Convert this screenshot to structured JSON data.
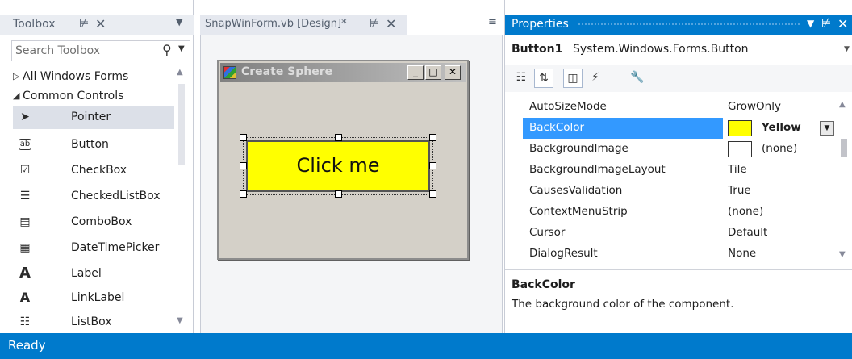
{
  "toolbox": {
    "title": "Toolbox",
    "search_placeholder": "Search Toolbox",
    "categories": [
      {
        "label": "All Windows Forms",
        "expanded": false
      },
      {
        "label": "Common Controls",
        "expanded": true
      }
    ],
    "items": [
      {
        "label": "Pointer",
        "icon": "pointer-icon",
        "selected": true
      },
      {
        "label": "Button",
        "icon": "button-icon"
      },
      {
        "label": "CheckBox",
        "icon": "checkbox-icon"
      },
      {
        "label": "CheckedListBox",
        "icon": "checkedlistbox-icon"
      },
      {
        "label": "ComboBox",
        "icon": "combobox-icon"
      },
      {
        "label": "DateTimePicker",
        "icon": "datetimepicker-icon"
      },
      {
        "label": "Label",
        "icon": "label-icon"
      },
      {
        "label": "LinkLabel",
        "icon": "linklabel-icon"
      },
      {
        "label": "ListBox",
        "icon": "listbox-icon"
      }
    ]
  },
  "designer": {
    "tab_title": "SnapWinForm.vb [Design]*",
    "form": {
      "title": "Create Sphere",
      "button_text": "Click me",
      "button_color": "#ffff00"
    }
  },
  "properties": {
    "title": "Properties",
    "object_name": "Button1",
    "object_type": "System.Windows.Forms.Button",
    "rows": [
      {
        "name": "AutoSizeMode",
        "value": "GrowOnly"
      },
      {
        "name": "BackColor",
        "value": "Yellow",
        "swatch": "#ffff00",
        "selected": true
      },
      {
        "name": "BackgroundImage",
        "value": "(none)",
        "swatch": "#ffffff"
      },
      {
        "name": "BackgroundImageLayout",
        "value": "Tile"
      },
      {
        "name": "CausesValidation",
        "value": "True"
      },
      {
        "name": "ContextMenuStrip",
        "value": "(none)"
      },
      {
        "name": "Cursor",
        "value": "Default"
      },
      {
        "name": "DialogResult",
        "value": "None"
      }
    ],
    "description_title": "BackColor",
    "description_text": "The background color of the component."
  },
  "status": {
    "text": "Ready"
  },
  "colors": {
    "accent": "#007acc",
    "selection": "#3399ff"
  }
}
